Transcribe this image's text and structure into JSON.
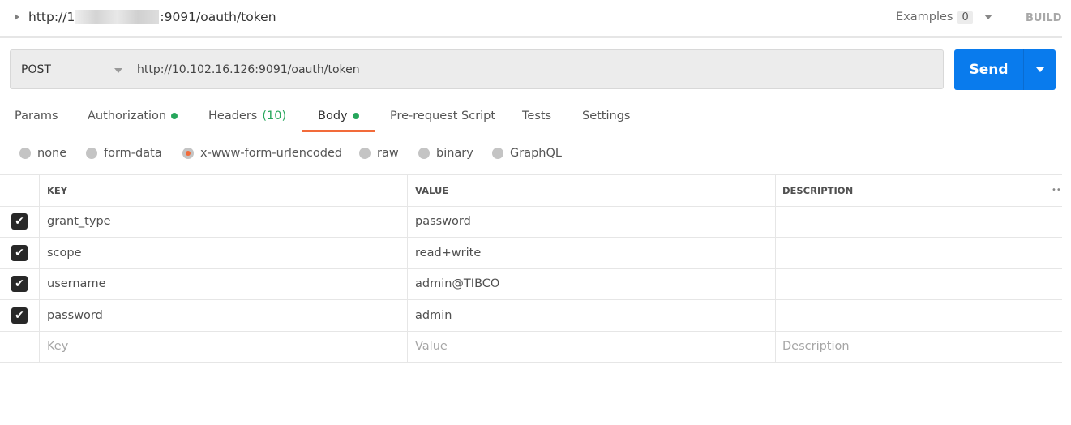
{
  "request": {
    "title_prefix": "http://1",
    "title_suffix": ":9091/oauth/token",
    "examples_label": "Examples",
    "examples_count": "0",
    "build_label": "BUILD",
    "method": "POST",
    "url": "http://10.102.16.126:9091/oauth/token",
    "send_label": "Send"
  },
  "tabs": [
    {
      "label": "Params"
    },
    {
      "label": "Authorization"
    },
    {
      "label": "Headers",
      "count": "(10)"
    },
    {
      "label": "Body"
    },
    {
      "label": "Pre-request Script"
    },
    {
      "label": "Tests"
    },
    {
      "label": "Settings"
    }
  ],
  "body_types": [
    "none",
    "form-data",
    "x-www-form-urlencoded",
    "raw",
    "binary",
    "GraphQL"
  ],
  "selected_body_type": "x-www-form-urlencoded",
  "table": {
    "headers": {
      "key": "KEY",
      "value": "VALUE",
      "description": "DESCRIPTION",
      "more": "••"
    },
    "rows": [
      {
        "key": "grant_type",
        "value": "password",
        "checked": true
      },
      {
        "key": "scope",
        "value": "read+write",
        "checked": true
      },
      {
        "key": "username",
        "value": "admin@TIBCO",
        "checked": true
      },
      {
        "key": "password",
        "value": "admin",
        "checked": true
      }
    ],
    "placeholders": {
      "key": "Key",
      "value": "Value",
      "description": "Description"
    }
  },
  "colors": {
    "accent": "#f26b3a",
    "send": "#097bed",
    "status": "#26a65b"
  }
}
